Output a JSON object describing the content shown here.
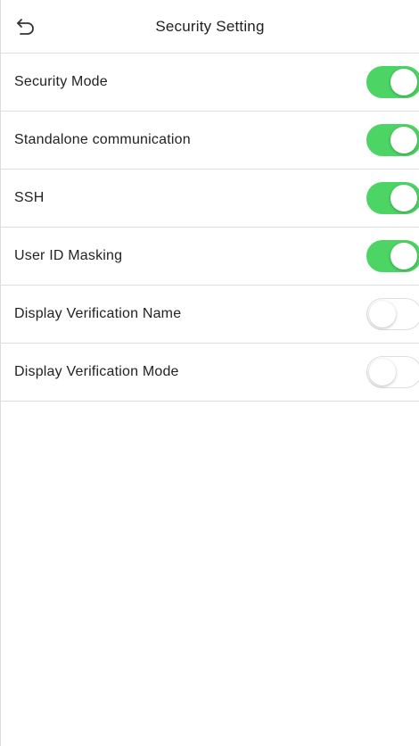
{
  "header": {
    "title": "Security Setting",
    "back_icon": "back-arrow-icon"
  },
  "colors": {
    "toggle_on": "#4cd464",
    "toggle_off_border": "#dedede",
    "divider": "#dddddd"
  },
  "settings": [
    {
      "label": "Security Mode",
      "enabled": true
    },
    {
      "label": "Standalone communication",
      "enabled": true
    },
    {
      "label": "SSH",
      "enabled": true
    },
    {
      "label": "User ID Masking",
      "enabled": true
    },
    {
      "label": "Display Verification Name",
      "enabled": false
    },
    {
      "label": "Display Verification Mode",
      "enabled": false
    }
  ]
}
